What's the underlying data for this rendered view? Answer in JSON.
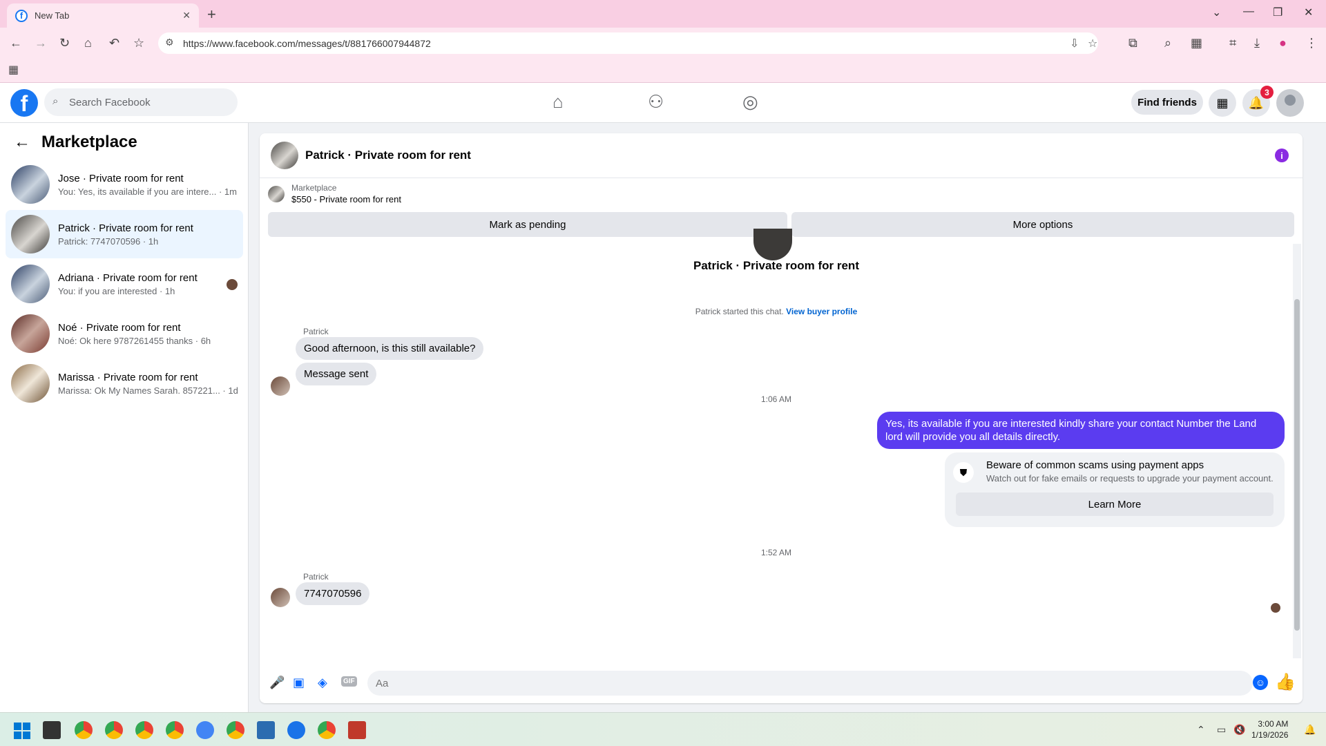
{
  "browser": {
    "tab_title": "New Tab",
    "url": "https://www.facebook.com/messages/t/881766007944872"
  },
  "fb": {
    "search_placeholder": "Search Facebook",
    "find_friends": "Find friends",
    "notification_count": "3"
  },
  "sidebar": {
    "title": "Marketplace",
    "conversations": [
      {
        "name": "Jose · Private room for rent",
        "preview": "You: Yes, its available if you are intere... · 1m"
      },
      {
        "name": "Patrick · Private room for rent",
        "preview": "Patrick: 7747070596 · 1h"
      },
      {
        "name": "Adriana · Private room for rent",
        "preview": "You: if you are interested · 1h"
      },
      {
        "name": "Noé · Private room for rent",
        "preview": "Noé: Ok here 9787261455 thanks · 6h"
      },
      {
        "name": "Marissa · Private room for rent",
        "preview": "Marissa: Ok My Names Sarah. 857221... · 1d"
      }
    ]
  },
  "chat": {
    "title": "Patrick · Private room for rent",
    "marketplace_label": "Marketplace",
    "listing": "$550 - Private room for rent",
    "mark_pending": "Mark as pending",
    "more_options": "More options",
    "center_title": "Patrick · Private room for rent",
    "started_note": "Patrick started this chat.",
    "view_profile": "View buyer profile",
    "sender1": "Patrick",
    "msg1": "Good afternoon, is this still available?",
    "msg2": "Message sent",
    "time1": "1:06 AM",
    "reply": "Yes, its available if you are interested kindly share your contact Number the Land lord will provide you all details directly.",
    "scam_title": "Beware of common scams using payment apps",
    "scam_text": "Watch out for fake emails or requests to upgrade your payment account.",
    "learn_more": "Learn More",
    "time2": "1:52 AM",
    "sender2": "Patrick",
    "msg3": "7747070596",
    "composer_placeholder": "Aa"
  },
  "taskbar": {
    "time": "3:00 AM",
    "date": "1/19/2026"
  }
}
